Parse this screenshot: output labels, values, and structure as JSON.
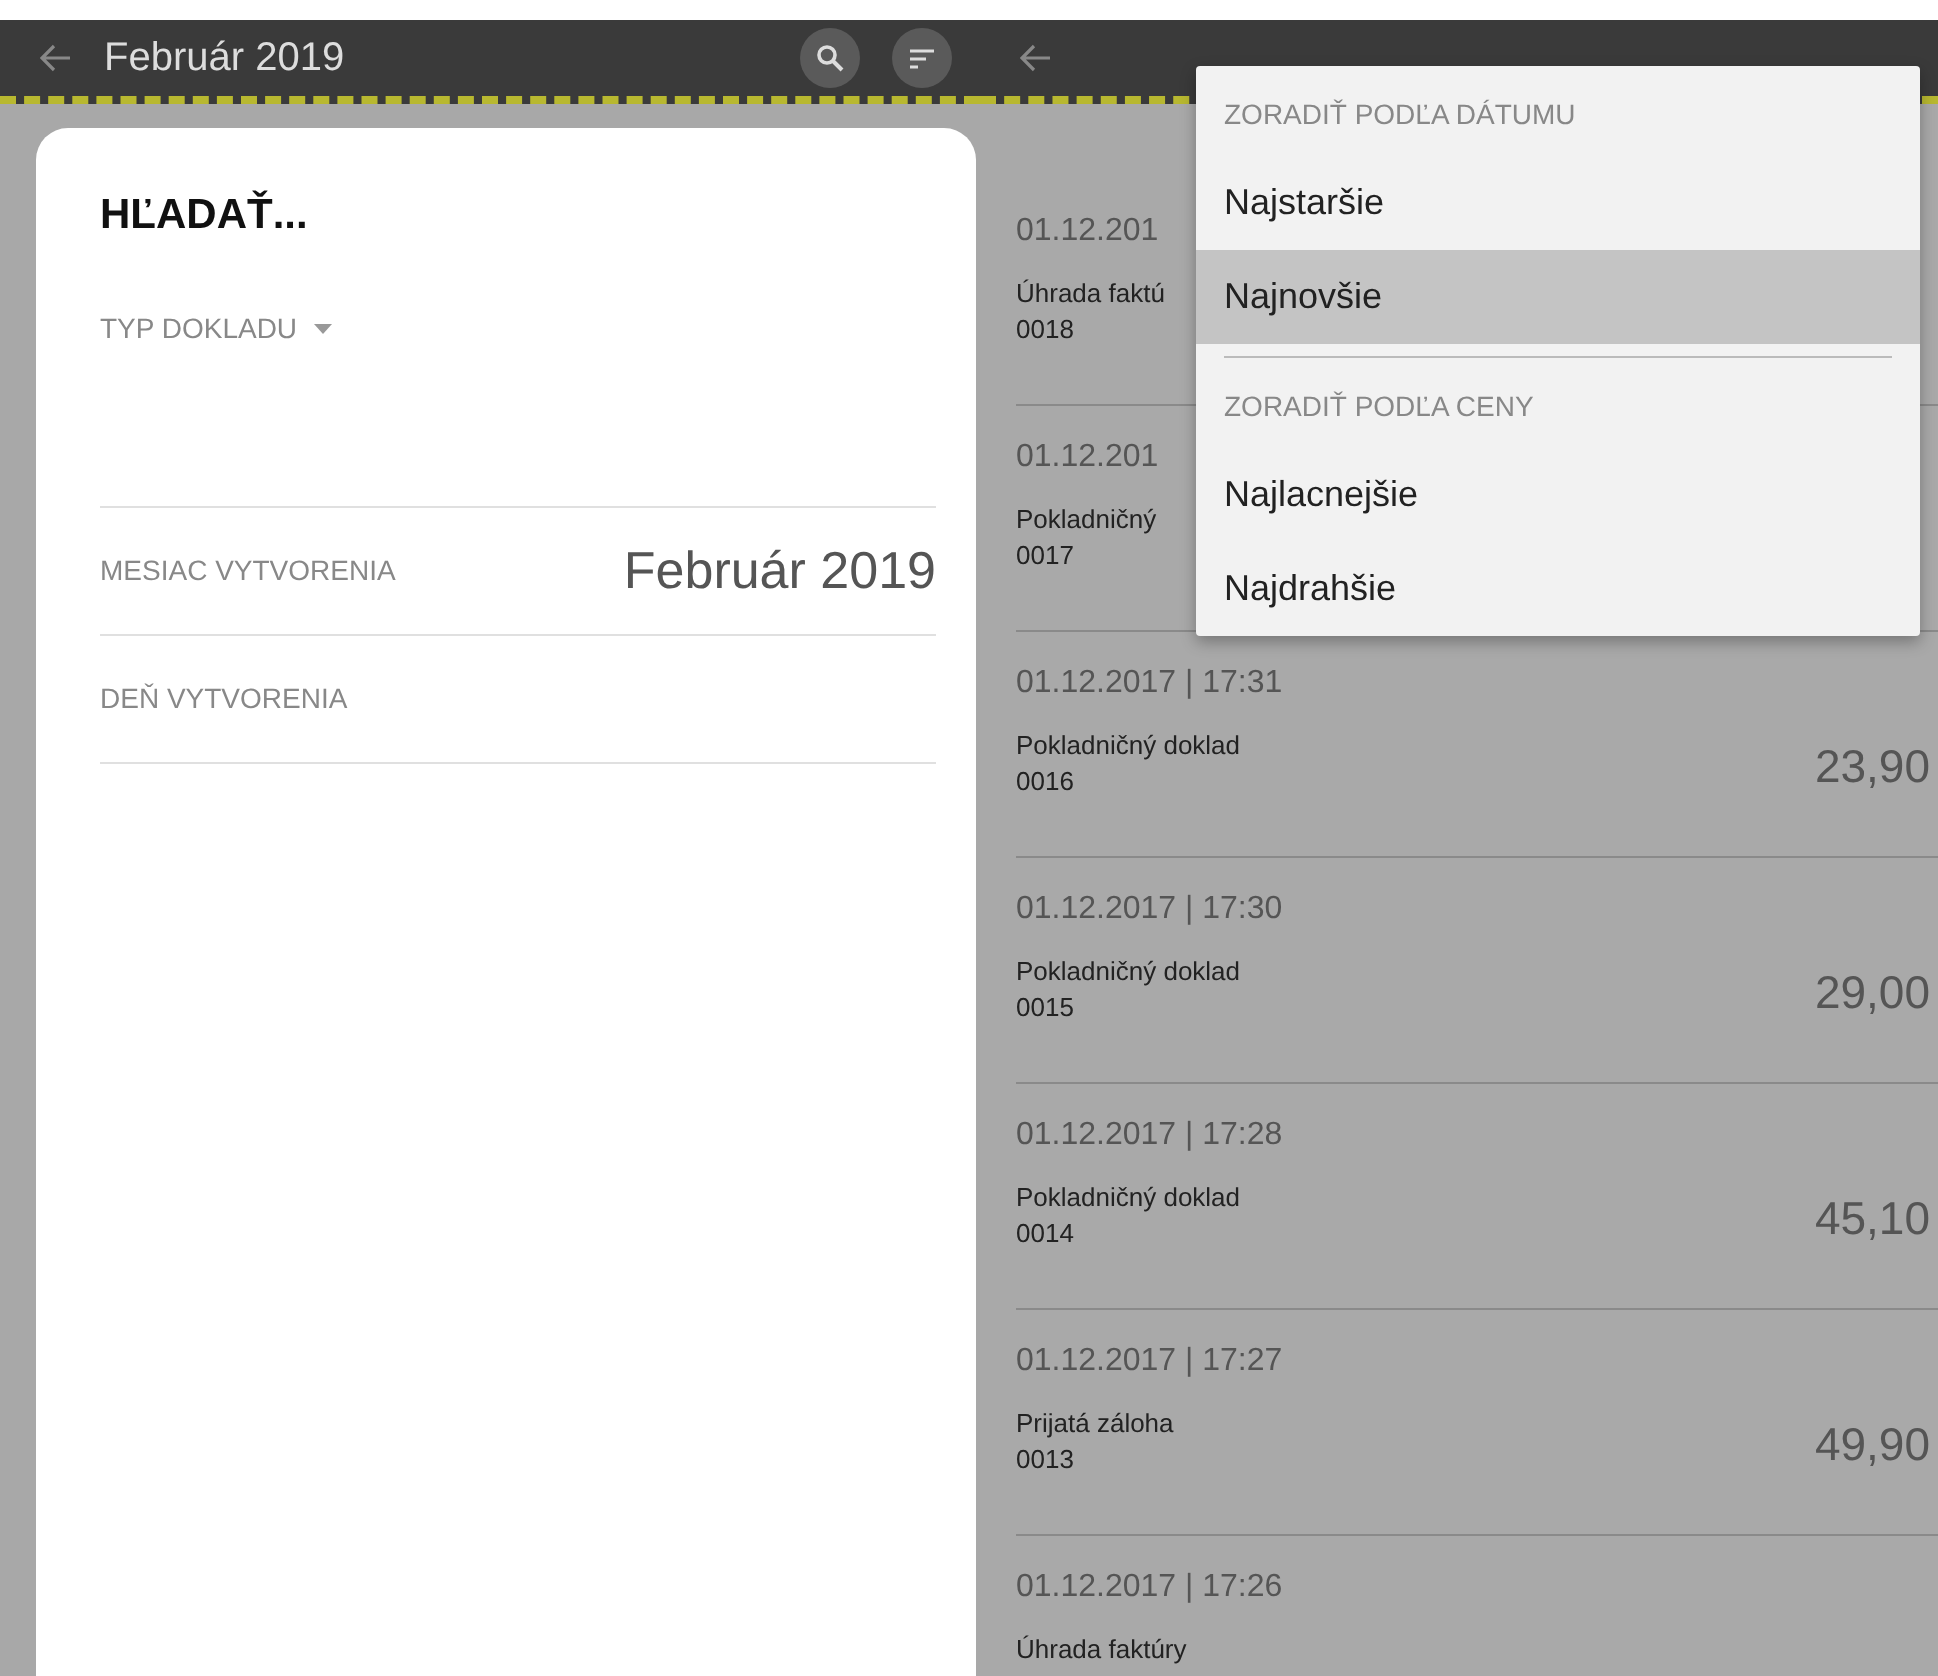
{
  "left_screen": {
    "app_bar": {
      "title": "Február 2019"
    },
    "search_form": {
      "title": "HĽADAŤ...",
      "fields": [
        {
          "kind": "dropdown",
          "label": "TYP DOKLADU"
        },
        {
          "kind": "value",
          "label": "MESIAC VYTVORENIA",
          "value": "Február 2019"
        },
        {
          "kind": "value",
          "label": "DEŇ VYTVORENIA"
        }
      ]
    }
  },
  "right_screen": {
    "documents": [
      {
        "datetime": "01.12.201",
        "type": "Úhrada faktú",
        "number": "0018"
      },
      {
        "datetime": "01.12.201",
        "type": "Pokladničný",
        "number": "0017"
      },
      {
        "datetime": "01.12.2017 | 17:31",
        "type": "Pokladničný doklad",
        "number": "0016",
        "amount": "23,90"
      },
      {
        "datetime": "01.12.2017 | 17:30",
        "type": "Pokladničný doklad",
        "number": "0015",
        "amount": "29,00"
      },
      {
        "datetime": "01.12.2017 | 17:28",
        "type": "Pokladničný doklad",
        "number": "0014",
        "amount": "45,10"
      },
      {
        "datetime": "01.12.2017 | 17:27",
        "type": "Prijatá záloha",
        "number": "0013",
        "amount": "49,90"
      },
      {
        "datetime": "01.12.2017 | 17:26",
        "type": "Úhrada faktúry"
      }
    ],
    "sort_menu": {
      "sections": [
        {
          "heading": "ZORADIŤ PODĽA DÁTUMU",
          "options": [
            {
              "label": "Najstaršie",
              "selected": false
            },
            {
              "label": "Najnovšie",
              "selected": true
            }
          ]
        },
        {
          "heading": "ZORADIŤ PODĽA CENY",
          "options": [
            {
              "label": "Najlacnejšie",
              "selected": false
            },
            {
              "label": "Najdrahšie",
              "selected": false
            }
          ]
        }
      ]
    }
  }
}
